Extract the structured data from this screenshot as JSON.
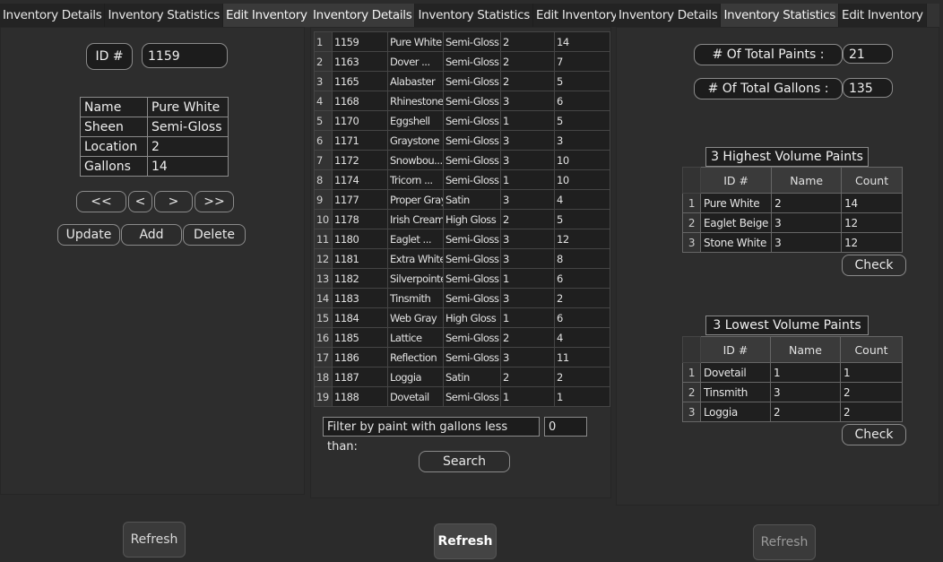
{
  "tabs": [
    "Inventory Details",
    "Inventory Statistics",
    "Edit Inventory"
  ],
  "edit": {
    "id_label": "ID #",
    "id_value": "1159",
    "fields": [
      {
        "label": "Name",
        "value": "Pure White"
      },
      {
        "label": "Sheen",
        "value": "Semi-Gloss"
      },
      {
        "label": "Location",
        "value": "2"
      },
      {
        "label": "Gallons",
        "value": "14"
      }
    ],
    "nav": {
      "first": "<<",
      "prev": "<",
      "next": ">",
      "last": ">>"
    },
    "update": "Update",
    "add": "Add",
    "delete": "Delete",
    "refresh": "Refresh"
  },
  "details": {
    "rows": [
      {
        "n": "1",
        "id": "1159",
        "name": "Pure White",
        "sheen": "Semi-Gloss",
        "loc": "2",
        "gal": "14"
      },
      {
        "n": "2",
        "id": "1163",
        "name": "Dover ...",
        "sheen": "Semi-Gloss",
        "loc": "2",
        "gal": "7"
      },
      {
        "n": "3",
        "id": "1165",
        "name": "Alabaster",
        "sheen": "Semi-Gloss",
        "loc": "2",
        "gal": "5"
      },
      {
        "n": "4",
        "id": "1168",
        "name": "Rhinestone",
        "sheen": "Semi-Gloss",
        "loc": "3",
        "gal": "6"
      },
      {
        "n": "5",
        "id": "1170",
        "name": "Eggshell",
        "sheen": "Semi-Gloss",
        "loc": "1",
        "gal": "5"
      },
      {
        "n": "6",
        "id": "1171",
        "name": "Graystone",
        "sheen": "Semi-Gloss",
        "loc": "3",
        "gal": "3"
      },
      {
        "n": "7",
        "id": "1172",
        "name": "Snowbou...",
        "sheen": "Semi-Gloss",
        "loc": "3",
        "gal": "10"
      },
      {
        "n": "8",
        "id": "1174",
        "name": "Tricorn ...",
        "sheen": "Semi-Gloss",
        "loc": "1",
        "gal": "10"
      },
      {
        "n": "9",
        "id": "1177",
        "name": "Proper Gray",
        "sheen": "Satin",
        "loc": "3",
        "gal": "4"
      },
      {
        "n": "10",
        "id": "1178",
        "name": "Irish Cream",
        "sheen": "High Gloss",
        "loc": "2",
        "gal": "5"
      },
      {
        "n": "11",
        "id": "1180",
        "name": "Eaglet ...",
        "sheen": "Semi-Gloss",
        "loc": "3",
        "gal": "12"
      },
      {
        "n": "12",
        "id": "1181",
        "name": "Extra White",
        "sheen": "Semi-Gloss",
        "loc": "3",
        "gal": "8"
      },
      {
        "n": "13",
        "id": "1182",
        "name": "Silverpointe",
        "sheen": "Semi-Gloss",
        "loc": "1",
        "gal": "6"
      },
      {
        "n": "14",
        "id": "1183",
        "name": "Tinsmith",
        "sheen": "Semi-Gloss",
        "loc": "3",
        "gal": "2"
      },
      {
        "n": "15",
        "id": "1184",
        "name": "Web Gray",
        "sheen": "High Gloss",
        "loc": "1",
        "gal": "6"
      },
      {
        "n": "16",
        "id": "1185",
        "name": "Lattice",
        "sheen": "Semi-Gloss",
        "loc": "2",
        "gal": "4"
      },
      {
        "n": "17",
        "id": "1186",
        "name": "Reflection",
        "sheen": "Semi-Gloss",
        "loc": "3",
        "gal": "11"
      },
      {
        "n": "18",
        "id": "1187",
        "name": "Loggia",
        "sheen": "Satin",
        "loc": "2",
        "gal": "2"
      },
      {
        "n": "19",
        "id": "1188",
        "name": "Dovetail",
        "sheen": "Semi-Gloss",
        "loc": "1",
        "gal": "1"
      }
    ],
    "filter_label": "Filter by paint with gallons less than:",
    "filter_value": "0",
    "search": "Search",
    "refresh": "Refresh"
  },
  "stats": {
    "total_paints_label": "# Of Total Paints :",
    "total_paints": "21",
    "total_gallons_label": "# Of Total Gallons :",
    "total_gallons": "135",
    "highest_title": "3 Highest Volume Paints",
    "lowest_title": "3 Lowest Volume Paints",
    "columns": [
      "ID #",
      "Name",
      "Count"
    ],
    "highest": [
      {
        "n": "1",
        "id": "Pure White",
        "name": "2",
        "count": "14"
      },
      {
        "n": "2",
        "id": "Eaglet Beige",
        "name": "3",
        "count": "12"
      },
      {
        "n": "3",
        "id": "Stone White",
        "name": "3",
        "count": "12"
      }
    ],
    "lowest": [
      {
        "n": "1",
        "id": "Dovetail",
        "name": "1",
        "count": "1"
      },
      {
        "n": "2",
        "id": "Tinsmith",
        "name": "3",
        "count": "2"
      },
      {
        "n": "3",
        "id": "Loggia",
        "name": "2",
        "count": "2"
      }
    ],
    "check": "Check",
    "refresh": "Refresh"
  }
}
